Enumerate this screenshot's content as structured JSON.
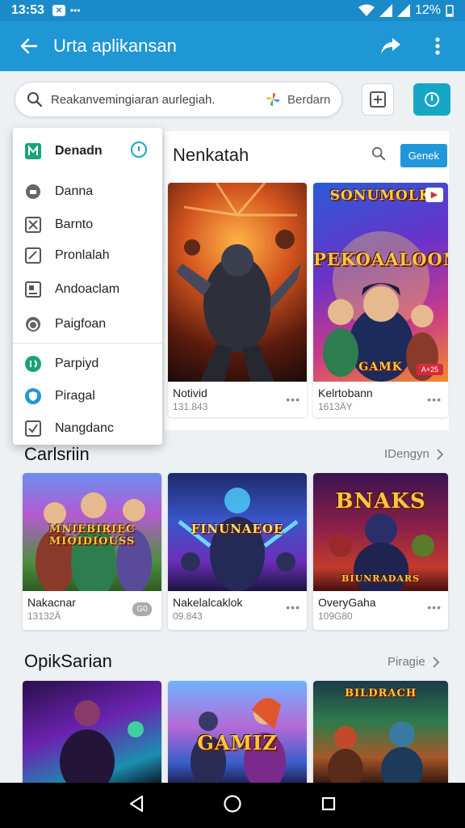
{
  "status_bar": {
    "time": "13:53",
    "battery": "12%"
  },
  "app_bar": {
    "title": "Urta aplikansan"
  },
  "search": {
    "placeholder": "Reakanvemingiaran aurlegiah.",
    "filter_label": "Berdarn"
  },
  "menu": {
    "items": [
      {
        "label": "Denadn",
        "icon": "grid-icon"
      },
      {
        "label": "Danna",
        "icon": "circle-icon"
      },
      {
        "label": "Barnto",
        "icon": "box-x-icon"
      },
      {
        "label": "Pronlalah",
        "icon": "edit-icon"
      },
      {
        "label": "Andoaclam",
        "icon": "calendar-icon"
      },
      {
        "label": "Paigfoan",
        "icon": "clock-icon"
      },
      {
        "label": "Parpiyd",
        "icon": "green-circle-icon"
      },
      {
        "label": "Piragal",
        "icon": "shield-icon"
      },
      {
        "label": "Nangdanc",
        "icon": "check-box-icon"
      }
    ]
  },
  "featured": {
    "title": "Nenkatah",
    "badge": "Genek",
    "cards": [
      {
        "name": "Notivid",
        "sub": "131.843",
        "art_text": ""
      },
      {
        "name": "Kelrtobann",
        "sub": "1613ÄY",
        "art_text": "PEKOAALOON",
        "top_text": "SONUMOLK",
        "bottom_text": "GAMK",
        "tag": "A+25"
      }
    ]
  },
  "sections": [
    {
      "title": "Carlsriin",
      "link": "IDengyn",
      "cards": [
        {
          "name": "Nakacnar",
          "sub": "13132Ä",
          "art_text": "MNIEBIRIEC\nMIOIDIOUSS",
          "chip": "G0"
        },
        {
          "name": "Nakelalcaklok",
          "sub": "09.843",
          "art_text": "FINUNAEOE"
        },
        {
          "name": "OveryGaha",
          "sub": "109G80",
          "art_text": "BNAKS",
          "bottom_text": "BIUNRADARS"
        }
      ]
    },
    {
      "title": "OpikSarian",
      "link": "Piragie",
      "cards": [
        {
          "art_text": ""
        },
        {
          "art_text": "GAMIZ"
        },
        {
          "art_text": "BILDRACH"
        }
      ]
    }
  ],
  "colors": {
    "app_bar": "#1f97d4",
    "status_bar": "#1a8bc8",
    "accent": "#17a7c5",
    "badge": "#2196d9"
  }
}
